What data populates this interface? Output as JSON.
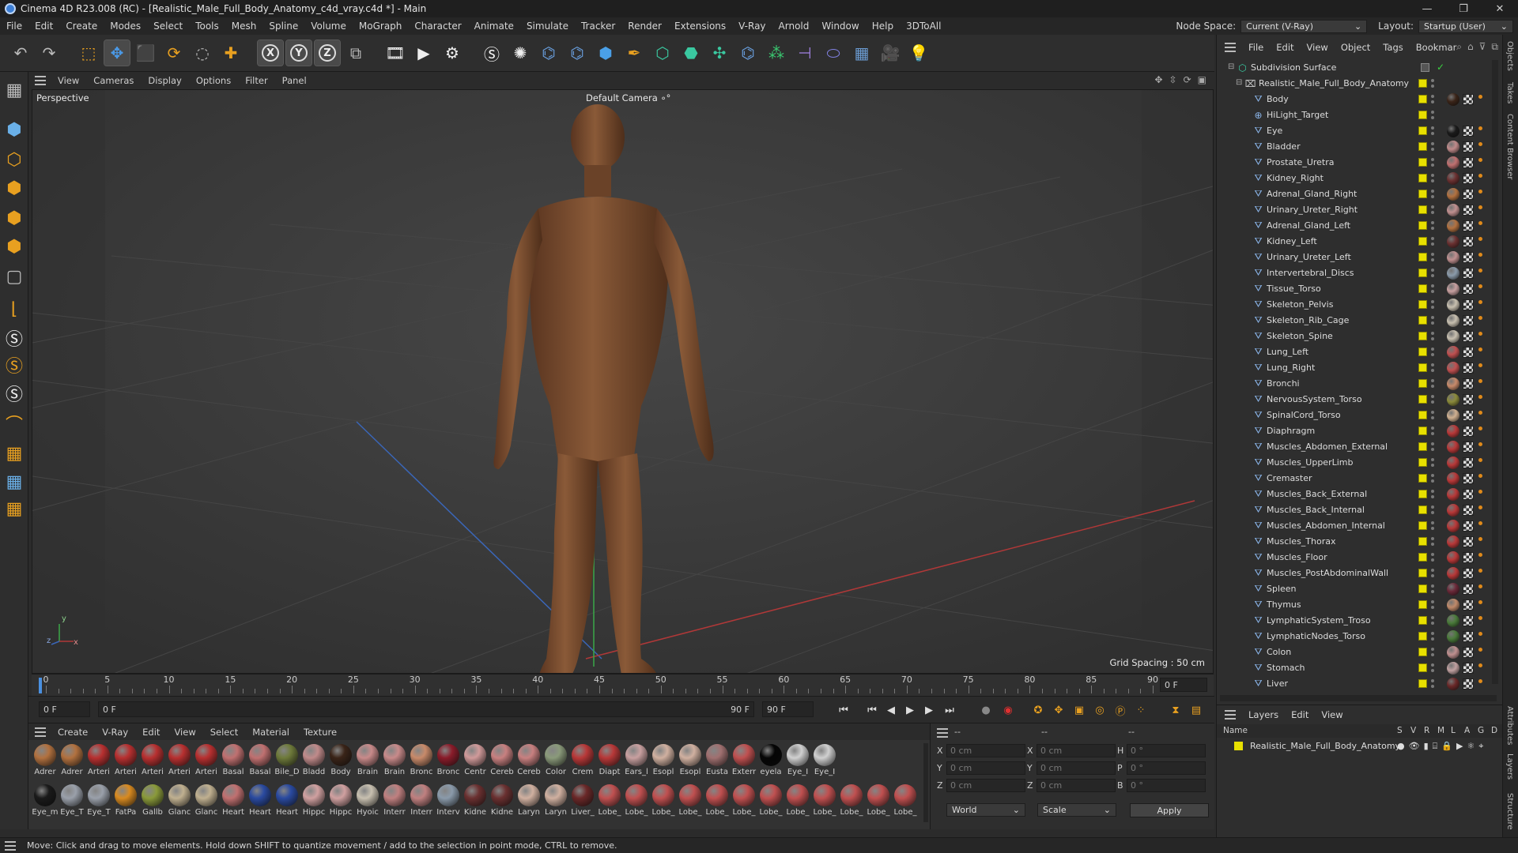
{
  "window": {
    "title": "Cinema 4D R23.008 (RC) - [Realistic_Male_Full_Body_Anatomy_c4d_vray.c4d *] - Main",
    "controls": [
      "—",
      "❐",
      "✕"
    ]
  },
  "menubar": {
    "items": [
      "File",
      "Edit",
      "Create",
      "Modes",
      "Select",
      "Tools",
      "Mesh",
      "Spline",
      "Volume",
      "MoGraph",
      "Character",
      "Animate",
      "Simulate",
      "Tracker",
      "Render",
      "Extensions",
      "V-Ray",
      "Arnold",
      "Window",
      "Help",
      "3DToAll"
    ],
    "node_space_label": "Node Space:",
    "node_space_value": "Current (V-Ray)",
    "layout_label": "Layout:",
    "layout_value": "Startup (User)"
  },
  "toolbar": {
    "icons": [
      "undo-icon",
      "redo-icon",
      "live-select-icon",
      "move-icon",
      "scale-icon",
      "rotate-icon",
      "last-tool-icon",
      "add-icon",
      "x-axis-icon",
      "y-axis-icon",
      "z-axis-icon",
      "coordinate-system-icon",
      "render-region-icon",
      "render-view-icon",
      "render-settings-icon",
      "vray-logo-icon",
      "vray-light-icon",
      "python-icon",
      "python-icon",
      "cube-icon",
      "pen-icon",
      "subdivision-icon",
      "extrude-icon",
      "cloner-icon",
      "python-icon",
      "mograph-icon",
      "deformer-icon",
      "tag-icon",
      "floor-icon",
      "camera-icon",
      "light-icon"
    ],
    "axis_letters": [
      "X",
      "Y",
      "Z"
    ]
  },
  "left_tools": {
    "icons": [
      "viewport-solo-icon",
      "model-mode-icon",
      "texture-mode-icon",
      "points-mode-icon",
      "edges-mode-icon",
      "polygons-mode-icon",
      "uv-mode-icon",
      "workplane-icon",
      "snap-icon",
      "snap-settings-icon",
      "snap-s-icon",
      "magnet-icon",
      "grid-icon",
      "grid-snap-icon",
      "locked-workplane-icon"
    ],
    "snap_letter": "S"
  },
  "viewport": {
    "menu": [
      "View",
      "Cameras",
      "Display",
      "Options",
      "Filter",
      "Panel"
    ],
    "label": "Perspective",
    "camera": "Default Camera",
    "camera_suffix": "∘°",
    "grid_spacing": "Grid Spacing : 50 cm",
    "axis_y": "y",
    "axis_z": "z",
    "axis_x": "x"
  },
  "timeline": {
    "ticks": [
      "0",
      "5",
      "10",
      "15",
      "20",
      "25",
      "30",
      "35",
      "40",
      "45",
      "50",
      "55",
      "60",
      "65",
      "70",
      "75",
      "80",
      "85",
      "90"
    ],
    "current_frame": "0 F"
  },
  "playbar": {
    "start_frame": "0 F",
    "range_start": "0 F",
    "range_end": "90 F",
    "end_frame": "90 F",
    "buttons": [
      "⏮",
      "⏮",
      "◀",
      "▶",
      "▶",
      "⏭"
    ]
  },
  "materials": {
    "menu": [
      "Create",
      "V-Ray",
      "Edit",
      "View",
      "Select",
      "Material",
      "Texture"
    ],
    "row1": [
      {
        "name": "Adrer",
        "color": "#b2713f"
      },
      {
        "name": "Adrer",
        "color": "#b2713f"
      },
      {
        "name": "Arteri",
        "color": "#b83030"
      },
      {
        "name": "Arteri",
        "color": "#b83030"
      },
      {
        "name": "Arteri",
        "color": "#b83030"
      },
      {
        "name": "Arteri",
        "color": "#b83030"
      },
      {
        "name": "Arteri",
        "color": "#b83030"
      },
      {
        "name": "Basal",
        "color": "#c07070"
      },
      {
        "name": "Basal",
        "color": "#c07070"
      },
      {
        "name": "Bile_D",
        "color": "#6e7a3a"
      },
      {
        "name": "Bladd",
        "color": "#c08a8a"
      },
      {
        "name": "Body",
        "color": "#3a2418"
      },
      {
        "name": "Brain",
        "color": "#c88a8a"
      },
      {
        "name": "Brain",
        "color": "#c88a8a"
      },
      {
        "name": "Bronc",
        "color": "#c88a6a"
      },
      {
        "name": "Bronc",
        "color": "#8a1c2a"
      },
      {
        "name": "Centr",
        "color": "#d09a9a"
      },
      {
        "name": "Cereb",
        "color": "#c88080"
      },
      {
        "name": "Cereb",
        "color": "#c88080"
      },
      {
        "name": "Color",
        "color": "#8a9a7a"
      },
      {
        "name": "Crem",
        "color": "#b83838"
      },
      {
        "name": "Diapt",
        "color": "#b83838"
      },
      {
        "name": "Ears_l",
        "color": "#c8a0a0"
      },
      {
        "name": "Esopl",
        "color": "#d0b0a0"
      },
      {
        "name": "Esopl",
        "color": "#d0b0a0"
      },
      {
        "name": "Eusta",
        "color": "#a07070"
      },
      {
        "name": "Exterr",
        "color": "#c05050"
      },
      {
        "name": "eyela",
        "color": "#050505"
      },
      {
        "name": "Eye_I",
        "color": "#d0d0d0"
      },
      {
        "name": "Eye_I",
        "color": "#d0d0d0"
      }
    ],
    "row2": [
      {
        "name": "Eye_m",
        "color": "#1a1a1a"
      },
      {
        "name": "Eye_T",
        "color": "#9aa0aa"
      },
      {
        "name": "Eye_T",
        "color": "#9aa0aa"
      },
      {
        "name": "FatPa",
        "color": "#d88a20"
      },
      {
        "name": "Gallb",
        "color": "#8a9a3a"
      },
      {
        "name": "Glanc",
        "color": "#c0b090"
      },
      {
        "name": "Glanc",
        "color": "#c0b090"
      },
      {
        "name": "Heart",
        "color": "#c07070"
      },
      {
        "name": "Heart",
        "color": "#2a4aa0"
      },
      {
        "name": "Heart",
        "color": "#2a4aa0"
      },
      {
        "name": "Hippc",
        "color": "#d0a0a0"
      },
      {
        "name": "Hippc",
        "color": "#d0a0a0"
      },
      {
        "name": "Hyoic",
        "color": "#c8c0b0"
      },
      {
        "name": "Interr",
        "color": "#c08080"
      },
      {
        "name": "Interr",
        "color": "#c08080"
      },
      {
        "name": "Interv",
        "color": "#8a9aaa"
      },
      {
        "name": "Kidne",
        "color": "#6a3030"
      },
      {
        "name": "Kidne",
        "color": "#6a3030"
      },
      {
        "name": "Laryn",
        "color": "#d0b0a0"
      },
      {
        "name": "Laryn",
        "color": "#d0b0a0"
      },
      {
        "name": "Liver_",
        "color": "#6a2828"
      },
      {
        "name": "Lobe_",
        "color": "#c05050"
      },
      {
        "name": "Lobe_",
        "color": "#c05050"
      },
      {
        "name": "Lobe_",
        "color": "#c05050"
      },
      {
        "name": "Lobe_",
        "color": "#c05050"
      },
      {
        "name": "Lobe_",
        "color": "#c05050"
      },
      {
        "name": "Lobe_",
        "color": "#c05050"
      },
      {
        "name": "Lobe_",
        "color": "#c05050"
      },
      {
        "name": "Lobe_",
        "color": "#c05050"
      },
      {
        "name": "Lobe_",
        "color": "#c05050"
      },
      {
        "name": "Lobe_",
        "color": "#c05050"
      },
      {
        "name": "Lobe_",
        "color": "#c05050"
      },
      {
        "name": "Lobe_",
        "color": "#c05050"
      }
    ]
  },
  "coords": {
    "header": [
      "--",
      "--",
      "--"
    ],
    "rows": [
      {
        "a": "X",
        "av": "0 cm",
        "b": "X",
        "bv": "0 cm",
        "c": "H",
        "cv": "0 °"
      },
      {
        "a": "Y",
        "av": "0 cm",
        "b": "Y",
        "bv": "0 cm",
        "c": "P",
        "cv": "0 °"
      },
      {
        "a": "Z",
        "av": "0 cm",
        "b": "Z",
        "bv": "0 cm",
        "c": "B",
        "cv": "0 °"
      }
    ],
    "mode": "World",
    "type": "Scale",
    "apply": "Apply"
  },
  "objects": {
    "menu": [
      "File",
      "Edit",
      "View",
      "Object",
      "Tags",
      "Bookmar"
    ],
    "root": "Subdivision Surface",
    "group": "Realistic_Male_Full_Body_Anatomy",
    "children": [
      {
        "name": "Body",
        "color": "#3a2418"
      },
      {
        "name": "HiLight_Target",
        "color": ""
      },
      {
        "name": "Eye",
        "color": "#1a1a1a"
      },
      {
        "name": "Bladder",
        "color": "#c08a8a"
      },
      {
        "name": "Prostate_Uretra",
        "color": "#c07070"
      },
      {
        "name": "Kidney_Right",
        "color": "#6a3030"
      },
      {
        "name": "Adrenal_Gland_Right",
        "color": "#b2713f"
      },
      {
        "name": "Urinary_Ureter_Right",
        "color": "#c09090"
      },
      {
        "name": "Adrenal_Gland_Left",
        "color": "#b2713f"
      },
      {
        "name": "Kidney_Left",
        "color": "#6a3030"
      },
      {
        "name": "Urinary_Ureter_Left",
        "color": "#c09090"
      },
      {
        "name": "Intervertebral_Discs",
        "color": "#8a9aaa"
      },
      {
        "name": "Tissue_Torso",
        "color": "#c8a0a0"
      },
      {
        "name": "Skeleton_Pelvis",
        "color": "#c8c0b0"
      },
      {
        "name": "Skeleton_Rib_Cage",
        "color": "#c8c0b0"
      },
      {
        "name": "Skeleton_Spine",
        "color": "#c8c0b0"
      },
      {
        "name": "Lung_Left",
        "color": "#c05050"
      },
      {
        "name": "Lung_Right",
        "color": "#c05050"
      },
      {
        "name": "Bronchi",
        "color": "#c88a6a"
      },
      {
        "name": "NervousSystem_Torso",
        "color": "#8a8a3a"
      },
      {
        "name": "SpinalCord_Torso",
        "color": "#d0b090"
      },
      {
        "name": "Diaphragm",
        "color": "#b83838"
      },
      {
        "name": "Muscles_Abdomen_External",
        "color": "#b83838"
      },
      {
        "name": "Muscles_UpperLimb",
        "color": "#b83838"
      },
      {
        "name": "Cremaster",
        "color": "#b83838"
      },
      {
        "name": "Muscles_Back_External",
        "color": "#b83838"
      },
      {
        "name": "Muscles_Back_Internal",
        "color": "#b83838"
      },
      {
        "name": "Muscles_Abdomen_Internal",
        "color": "#b83838"
      },
      {
        "name": "Muscles_Thorax",
        "color": "#b83838"
      },
      {
        "name": "Muscles_Floor",
        "color": "#b83838"
      },
      {
        "name": "Muscles_PostAbdominalWall",
        "color": "#b83838"
      },
      {
        "name": "Spleen",
        "color": "#6a2838"
      },
      {
        "name": "Thymus",
        "color": "#c08a6a"
      },
      {
        "name": "LymphaticSystem_Troso",
        "color": "#4a7a3a"
      },
      {
        "name": "LymphaticNodes_Torso",
        "color": "#4a7a3a"
      },
      {
        "name": "Colon",
        "color": "#c09090"
      },
      {
        "name": "Stomach",
        "color": "#c0a0a0"
      },
      {
        "name": "Liver",
        "color": "#6a2828"
      }
    ]
  },
  "layers": {
    "menu": [
      "Layers",
      "Edit",
      "View"
    ],
    "head_name": "Name",
    "head_flags": [
      "S",
      "V",
      "R",
      "M",
      "L",
      "A",
      "G",
      "D"
    ],
    "row": "Realistic_Male_Full_Body_Anatomy"
  },
  "side_tabs": [
    "Objects",
    "Takes",
    "Content Browser",
    "Attributes",
    "Layers",
    "Structure"
  ],
  "status": "Move: Click and drag to move elements. Hold down SHIFT to quantize movement / add to the selection in point mode, CTRL to remove."
}
